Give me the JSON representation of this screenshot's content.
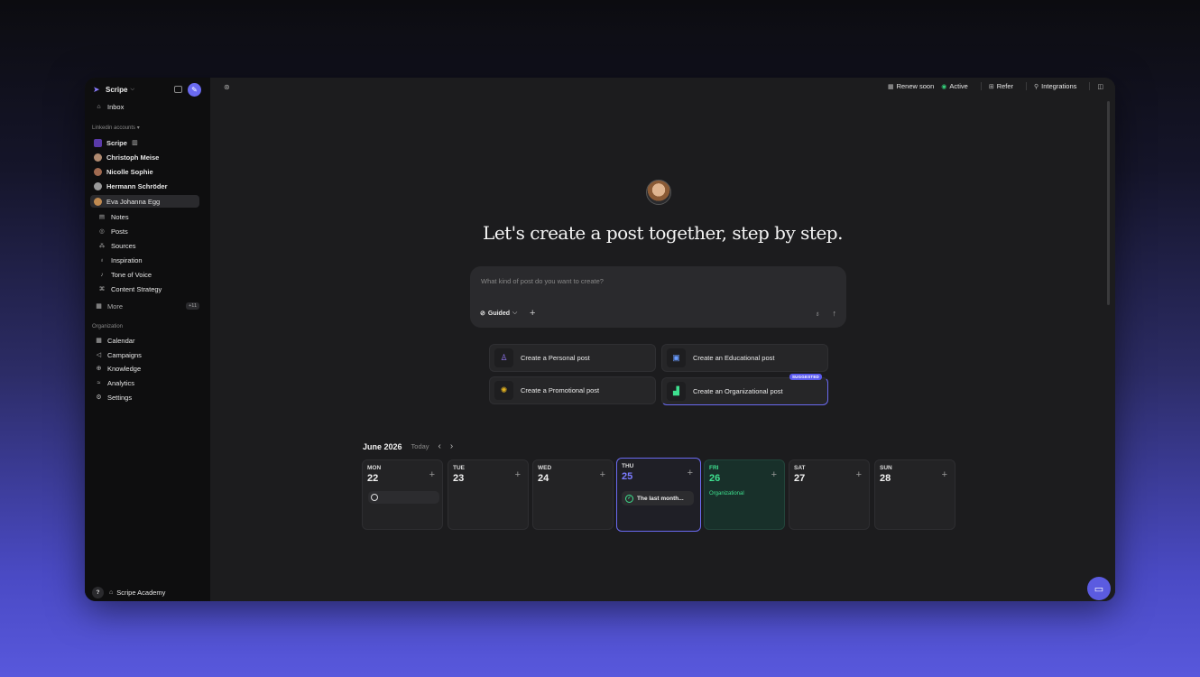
{
  "brand": {
    "name": "Scripe"
  },
  "sidebar": {
    "inbox": "Inbox",
    "linkedin_section": "Linkedin accounts ▾",
    "accounts": [
      {
        "label": "Scripe"
      },
      {
        "label": "Christoph Meise"
      },
      {
        "label": "Nicolle Sophie"
      },
      {
        "label": "Hermann Schröder"
      },
      {
        "label": "Eva Johanna Egg"
      }
    ],
    "sub_items": [
      {
        "label": "Notes",
        "icon": "notes-icon"
      },
      {
        "label": "Posts",
        "icon": "posts-icon"
      },
      {
        "label": "Sources",
        "icon": "sources-icon"
      },
      {
        "label": "Inspiration",
        "icon": "lightbulb-icon"
      },
      {
        "label": "Tone of Voice",
        "icon": "voice-icon"
      },
      {
        "label": "Content Strategy",
        "icon": "strategy-icon"
      }
    ],
    "more": "More",
    "more_badge": "+11",
    "org_section": "Organization",
    "org_items": [
      {
        "label": "Calendar",
        "icon": "calendar-icon"
      },
      {
        "label": "Campaigns",
        "icon": "megaphone-icon"
      },
      {
        "label": "Knowledge",
        "icon": "globe-icon"
      },
      {
        "label": "Analytics",
        "icon": "chart-icon"
      },
      {
        "label": "Settings",
        "icon": "gear-icon"
      }
    ],
    "help": "?",
    "academy": "Scripe Academy"
  },
  "topbar": {
    "renew": "Renew soon",
    "active": "Active",
    "refer": "Refer",
    "integrations": "Integrations"
  },
  "hero": {
    "title": "Let's create a post together, step by step."
  },
  "composer": {
    "placeholder": "What kind of post do you want to create?",
    "mode": "Guided"
  },
  "cards": {
    "personal": "Create a Personal post",
    "educational": "Create an Educational post",
    "promotional": "Create a Promotional post",
    "organizational": "Create an Organizational post",
    "suggested_badge": "SUGGESTED"
  },
  "calendar": {
    "month": "June 2026",
    "today": "Today",
    "days": [
      {
        "name": "MON",
        "num": "22"
      },
      {
        "name": "TUE",
        "num": "23"
      },
      {
        "name": "WED",
        "num": "24"
      },
      {
        "name": "THU",
        "num": "25",
        "post": "The last month..."
      },
      {
        "name": "FRI",
        "num": "26",
        "tag": "Organizational"
      },
      {
        "name": "SAT",
        "num": "27"
      },
      {
        "name": "SUN",
        "num": "28"
      }
    ]
  },
  "colors": {
    "accent": "#6a6af0",
    "success": "#3ee08f"
  }
}
